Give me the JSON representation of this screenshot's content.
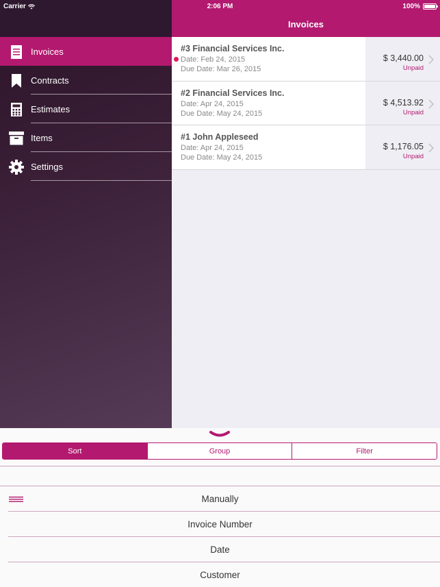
{
  "status_bar": {
    "carrier": "Carrier",
    "time": "2:06 PM",
    "battery": "100%"
  },
  "nav_bar": {
    "title": "Invoices"
  },
  "sidebar": {
    "items": [
      {
        "label": "Invoices",
        "icon": "invoice-icon",
        "active": true
      },
      {
        "label": "Contracts",
        "icon": "bookmark-icon",
        "active": false
      },
      {
        "label": "Estimates",
        "icon": "calculator-icon",
        "active": false
      },
      {
        "label": "Items",
        "icon": "archive-box-icon",
        "active": false
      },
      {
        "label": "Settings",
        "icon": "gear-icon",
        "active": false
      }
    ]
  },
  "invoices": [
    {
      "title": "#3 Financial Services Inc.",
      "date": "Date: Feb 24, 2015",
      "due": "Due Date: Mar 26, 2015",
      "amount": "$ 3,440.00",
      "status": "Unpaid",
      "unread": true
    },
    {
      "title": "#2 Financial Services Inc.",
      "date": "Date: Apr 24, 2015",
      "due": "Due Date: May 24, 2015",
      "amount": "$ 4,513.92",
      "status": "Unpaid",
      "unread": false
    },
    {
      "title": "#1 John Appleseed",
      "date": "Date: Apr 24, 2015",
      "due": "Due Date: May 24, 2015",
      "amount": "$ 1,176.05",
      "status": "Unpaid",
      "unread": false
    }
  ],
  "bottom_panel": {
    "segments": [
      {
        "label": "Sort",
        "active": true
      },
      {
        "label": "Group",
        "active": false
      },
      {
        "label": "Filter",
        "active": false
      }
    ],
    "sort_options": [
      "Manually",
      "Invoice Number",
      "Date",
      "Customer"
    ]
  },
  "colors": {
    "accent": "#b3196f",
    "unread_dot": "#e0195a",
    "sidebar_dark": "#2b1428"
  }
}
